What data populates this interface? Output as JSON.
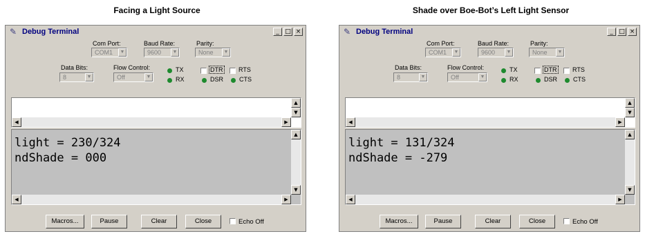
{
  "panels": [
    {
      "caption": "Facing a Light Source",
      "window_title": "Debug Terminal",
      "com_port_label": "Com Port:",
      "com_port_value": "COM1",
      "baud_label": "Baud Rate:",
      "baud_value": "9600",
      "parity_label": "Parity:",
      "parity_value": "None",
      "data_bits_label": "Data Bits:",
      "data_bits_value": "8",
      "flow_label": "Flow Control:",
      "flow_value": "Off",
      "tx": "TX",
      "rx": "RX",
      "dtr": "DTR",
      "dsr": "DSR",
      "rts": "RTS",
      "cts": "CTS",
      "line1": "light = 230/324",
      "line2": "ndShade = 000",
      "macros": "Macros...",
      "pause": "Pause",
      "clear": "Clear",
      "close": "Close",
      "echo_off": "Echo Off"
    },
    {
      "caption": "Shade over Boe-Bot’s Left Light Sensor",
      "window_title": "Debug Terminal",
      "com_port_label": "Com Port:",
      "com_port_value": "COM1",
      "baud_label": "Baud Rate:",
      "baud_value": "9600",
      "parity_label": "Parity:",
      "parity_value": "None",
      "data_bits_label": "Data Bits:",
      "data_bits_value": "8",
      "flow_label": "Flow Control:",
      "flow_value": "Off",
      "tx": "TX",
      "rx": "RX",
      "dtr": "DTR",
      "dsr": "DSR",
      "rts": "RTS",
      "cts": "CTS",
      "line1": "light = 131/324",
      "line2": "ndShade = -279",
      "macros": "Macros...",
      "pause": "Pause",
      "clear": "Clear",
      "close": "Close",
      "echo_off": "Echo Off"
    }
  ],
  "colors": {
    "window_bg": "#d4d0c8",
    "title_text": "#000080",
    "led_green": "#1e8a2e",
    "rx_bg": "#c0c0c0"
  }
}
